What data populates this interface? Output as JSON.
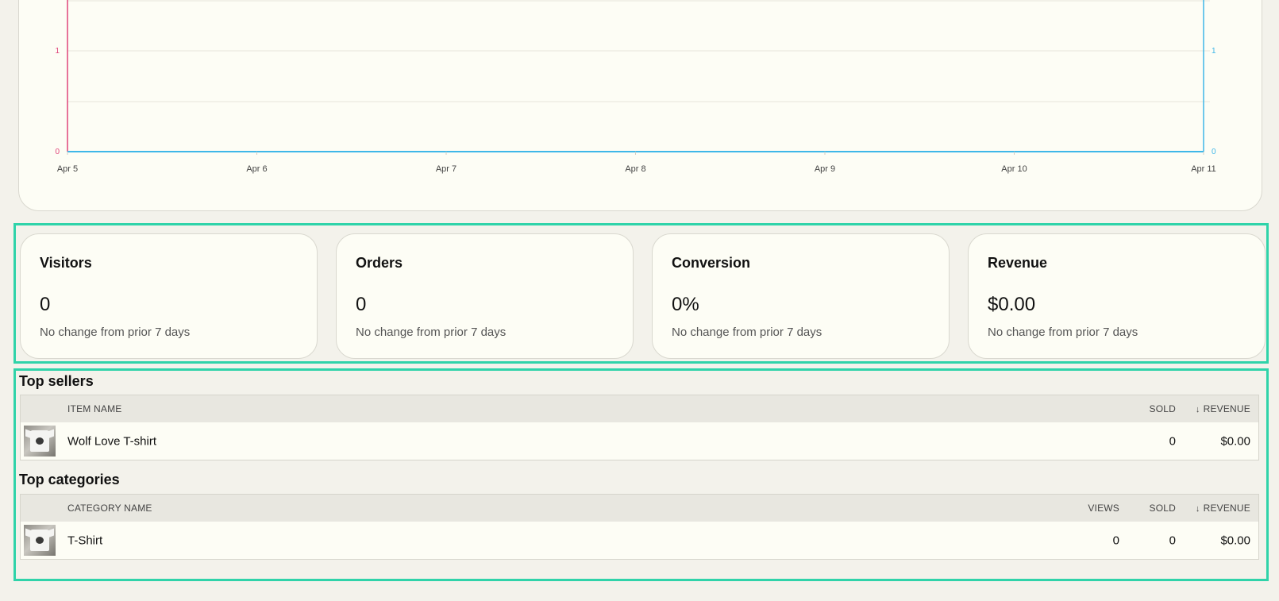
{
  "chart_data": {
    "type": "line",
    "categories": [
      "Apr 5",
      "Apr 6",
      "Apr 7",
      "Apr 8",
      "Apr 9",
      "Apr 10",
      "Apr 11"
    ],
    "series": [
      {
        "values": [
          0,
          0,
          0,
          0,
          0,
          0,
          0
        ],
        "color": "#e0457b",
        "axis": "left"
      },
      {
        "values": [
          0,
          0,
          0,
          0,
          0,
          0,
          0
        ],
        "color": "#3fb7e8",
        "axis": "right"
      }
    ],
    "y_left_ticks": [
      "0",
      "1"
    ],
    "y_right_ticks": [
      "0",
      "1"
    ],
    "ylim": [
      0,
      1
    ],
    "grid": true
  },
  "stats": [
    {
      "title": "Visitors",
      "value": "0",
      "change": "No change from prior 7 days"
    },
    {
      "title": "Orders",
      "value": "0",
      "change": "No change from prior 7 days"
    },
    {
      "title": "Conversion",
      "value": "0%",
      "change": "No change from prior 7 days"
    },
    {
      "title": "Revenue",
      "value": "$0.00",
      "change": "No change from prior 7 days"
    }
  ],
  "top_sellers": {
    "heading": "Top sellers",
    "columns": {
      "item_name": "ITEM NAME",
      "sold": "SOLD",
      "revenue": "REVENUE"
    },
    "sort_icon": "arrow-down-icon",
    "rows": [
      {
        "name": "Wolf Love T-shirt",
        "sold": "0",
        "revenue": "$0.00"
      }
    ]
  },
  "top_categories": {
    "heading": "Top categories",
    "columns": {
      "category_name": "CATEGORY NAME",
      "views": "VIEWS",
      "sold": "SOLD",
      "revenue": "REVENUE"
    },
    "sort_icon": "arrow-down-icon",
    "rows": [
      {
        "name": "T-Shirt",
        "views": "0",
        "sold": "0",
        "revenue": "$0.00"
      }
    ]
  },
  "colors": {
    "accent_outline": "#2fd3a9",
    "left_axis": "#e0457b",
    "right_axis": "#3fb7e8"
  }
}
